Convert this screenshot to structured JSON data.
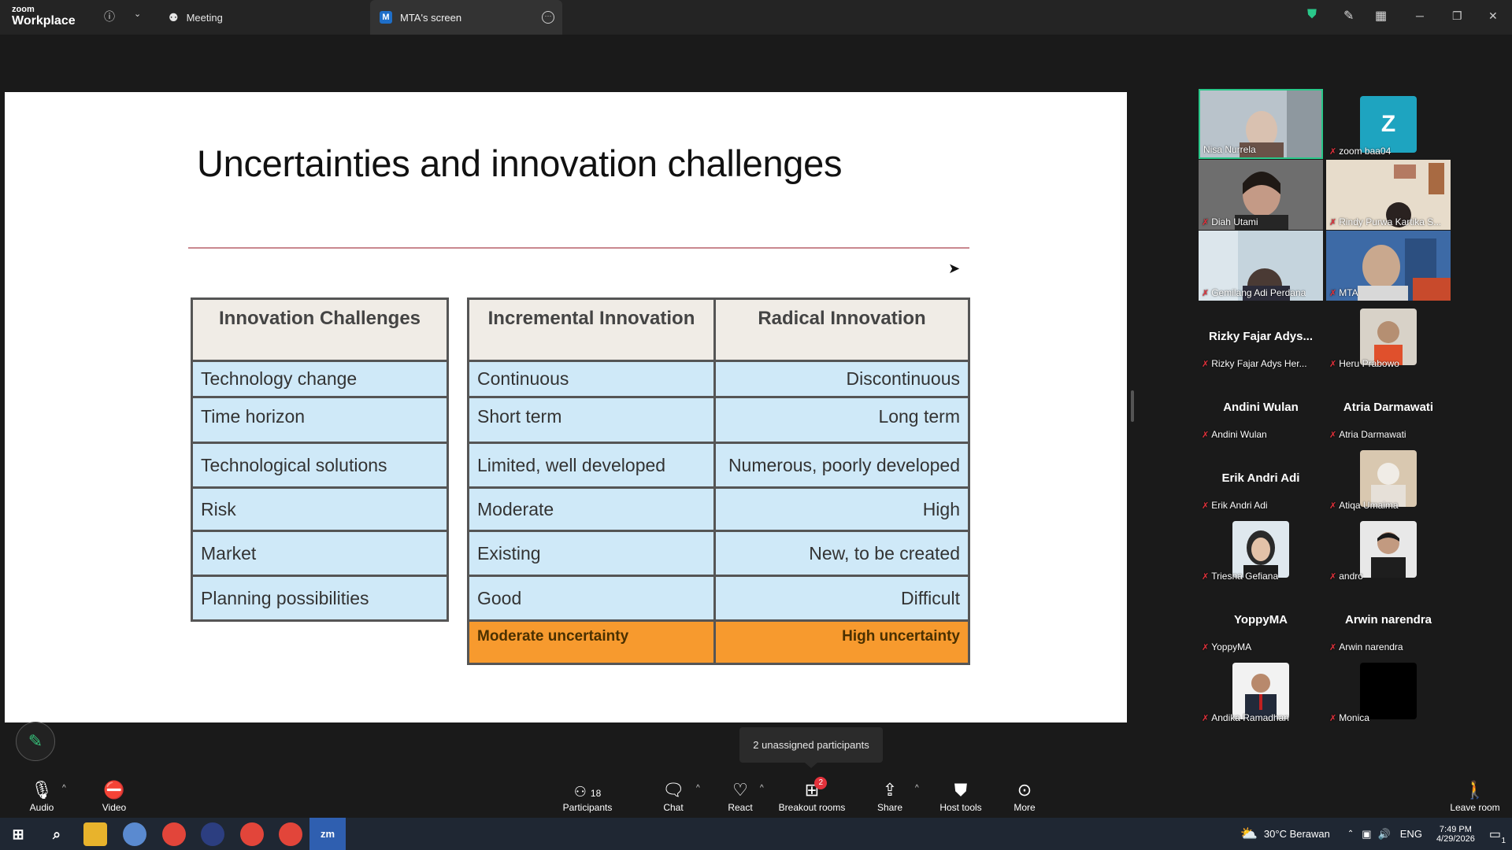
{
  "app": {
    "logo_top": "zoom",
    "logo_bottom": "Workplace"
  },
  "tabs": {
    "meeting": "Meeting",
    "screen": "MTA's screen",
    "screen_badge": "M"
  },
  "slide": {
    "title": "Uncertainties and innovation challenges",
    "left_header": "Innovation Challenges",
    "mid_header": "Incremental Innovation",
    "right_header": "Radical Innovation",
    "rows": [
      {
        "challenge": "Technology change",
        "incremental": "Continuous",
        "radical": "Discontinuous"
      },
      {
        "challenge": "Time horizon",
        "incremental": "Short term",
        "radical": "Long term"
      },
      {
        "challenge": "Technological solutions",
        "incremental": "Limited, well developed",
        "radical": "Numerous,  poorly developed"
      },
      {
        "challenge": "Risk",
        "incremental": "Moderate",
        "radical": "High"
      },
      {
        "challenge": "Market",
        "incremental": "Existing",
        "radical": "New, to be created"
      },
      {
        "challenge": "Planning possibilities",
        "incremental": "Good",
        "radical": "Difficult"
      }
    ],
    "uncertainty_incremental": "Moderate uncertainty",
    "uncertainty_radical": "High uncertainty"
  },
  "participants": [
    {
      "name": "Nisa Nurrela",
      "type": "video"
    },
    {
      "name": "zoom baa04",
      "type": "letter",
      "letter": "Z"
    },
    {
      "name": "Diah Utami",
      "type": "video"
    },
    {
      "name": "Rindy Purwa Kartika S...",
      "type": "video"
    },
    {
      "name": "Gemilang Adi Perdana",
      "type": "video"
    },
    {
      "name": "MTA",
      "type": "video"
    },
    {
      "name": "Rizky Fajar Adys Her...",
      "type": "name",
      "display": "Rizky Fajar Adys..."
    },
    {
      "name": "Heru Prabowo",
      "type": "photo"
    },
    {
      "name": "Andini Wulan",
      "type": "name",
      "display": "Andini Wulan"
    },
    {
      "name": "Atria Darmawati",
      "type": "name",
      "display": "Atria Darmawati"
    },
    {
      "name": "Erik Andri Adi",
      "type": "name",
      "display": "Erik Andri Adi"
    },
    {
      "name": "Atiqa Umaima",
      "type": "photo"
    },
    {
      "name": "Triesna Gefiana",
      "type": "photo"
    },
    {
      "name": "andro",
      "type": "photo"
    },
    {
      "name": "YoppyMA",
      "type": "name",
      "display": "YoppyMA"
    },
    {
      "name": "Arwin narendra",
      "type": "name",
      "display": "Arwin narendra"
    },
    {
      "name": "Andika Ramadhan",
      "type": "photo"
    },
    {
      "name": "Monica",
      "type": "photo"
    }
  ],
  "tooltip": "2 unassigned participants",
  "toolbar": {
    "audio": "Audio",
    "video": "Video",
    "participants": "Participants",
    "participants_count": "18",
    "chat": "Chat",
    "react": "React",
    "breakout": "Breakout rooms",
    "breakout_badge": "2",
    "share": "Share",
    "host_tools": "Host tools",
    "more": "More",
    "leave": "Leave room"
  },
  "taskbar": {
    "weather": "30°C  Berawan",
    "lang": "ENG",
    "time": "7:49 PM",
    "date": "4/29/2026",
    "notif": "1",
    "zm": "zm"
  },
  "colors": {
    "accent_green": "#2ac88a",
    "mute_red": "#e3323c",
    "uncertainty_orange": "#f79a2e",
    "cell_blue": "#cfe9f8"
  }
}
